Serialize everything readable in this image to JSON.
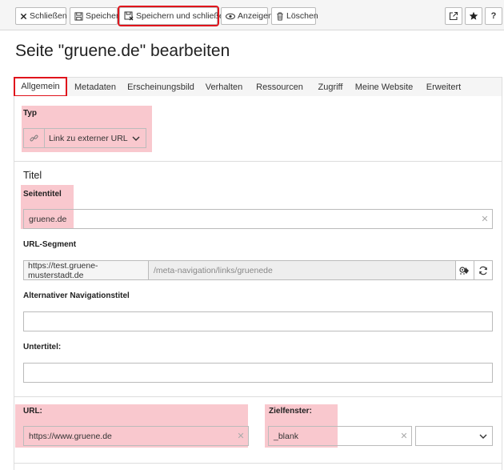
{
  "toolbar": {
    "close_label": "Schließen",
    "save_label": "Speichern",
    "save_close_label": "Speichern und schließen",
    "view_label": "Anzeigen",
    "delete_label": "Löschen",
    "help_label": "?"
  },
  "page": {
    "title": "Seite \"gruene.de\" bearbeiten"
  },
  "tabs": [
    {
      "label": "Allgemein"
    },
    {
      "label": "Metadaten"
    },
    {
      "label": "Erscheinungsbild"
    },
    {
      "label": "Verhalten"
    },
    {
      "label": "Ressourcen"
    },
    {
      "label": "Zugriff"
    },
    {
      "label": "Meine Website"
    },
    {
      "label": "Erweitert"
    }
  ],
  "typ": {
    "label": "Typ",
    "value": "Link zu externer URL"
  },
  "titel_section": "Titel",
  "seitentitel": {
    "label": "Seitentitel",
    "value": "gruene.de"
  },
  "url_segment": {
    "label": "URL-Segment",
    "prefix": "https://test.gruene-musterstadt.de",
    "path": "/meta-navigation/links/gruenede"
  },
  "nav_title": {
    "label": "Alternativer Navigationstitel",
    "value": ""
  },
  "subtitle": {
    "label": "Untertitel:",
    "value": ""
  },
  "url": {
    "label": "URL:",
    "value": "https://www.gruene.de"
  },
  "target": {
    "label": "Zielfenster:",
    "value": "_blank",
    "select_value": ""
  }
}
